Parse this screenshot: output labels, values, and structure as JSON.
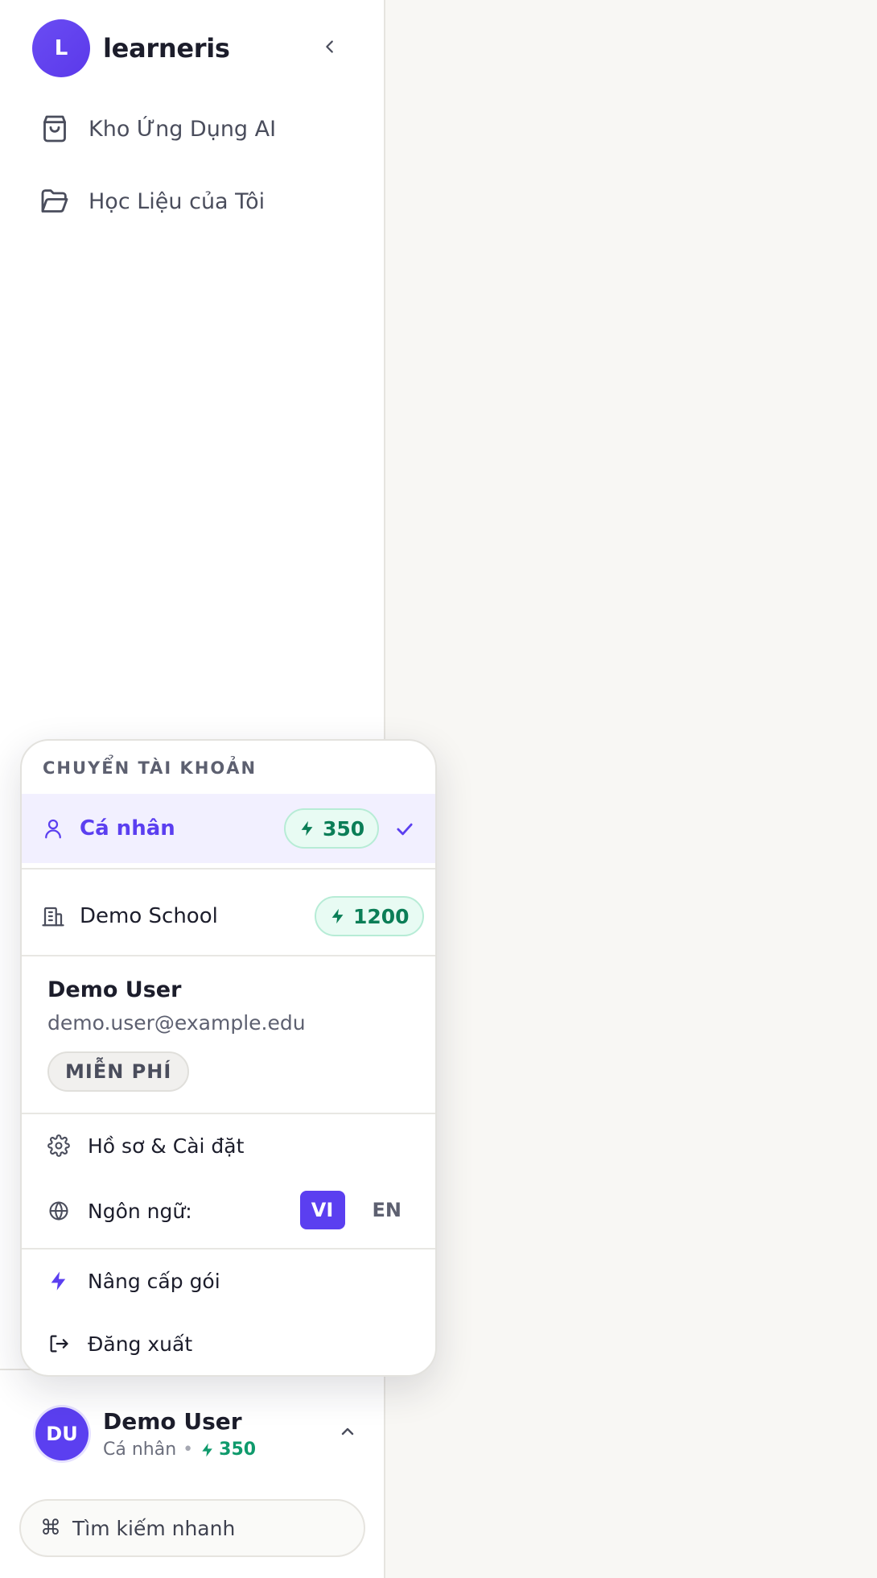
{
  "brand": {
    "logo_letter": "L",
    "name": "learneris"
  },
  "nav": {
    "items": [
      {
        "label": "Kho Ứng Dụng AI",
        "icon": "shopping-bag-icon"
      },
      {
        "label": "Học Liệu của Tôi",
        "icon": "folder-open-icon"
      }
    ]
  },
  "account_menu": {
    "section_title": "CHUYỂN TÀI KHOẢN",
    "accounts": [
      {
        "label": "Cá nhân",
        "credits": "350",
        "selected": true,
        "icon": "user-icon"
      },
      {
        "label": "Demo School",
        "credits": "1200",
        "selected": false,
        "icon": "building-icon"
      }
    ],
    "profile": {
      "name": "Demo User",
      "email": "demo.user@example.edu",
      "plan": "MIỄN PHÍ"
    },
    "settings_label": "Hồ sơ & Cài đặt",
    "language_label": "Ngôn ngữ:",
    "languages": [
      "VI",
      "EN"
    ],
    "active_language": "VI",
    "upgrade_label": "Nâng cấp gói",
    "logout_label": "Đăng xuất"
  },
  "user_card": {
    "initials": "DU",
    "name": "Demo User",
    "account_type": "Cá nhân",
    "separator": "•",
    "credits": "350"
  },
  "search": {
    "label": "Tìm kiếm nhanh",
    "shortcut_symbol": "⌘"
  },
  "colors": {
    "accent": "#5b3ff0",
    "credit_green": "#0b7e57",
    "background": "#f8f7f4",
    "sidebar": "#ffffff"
  }
}
